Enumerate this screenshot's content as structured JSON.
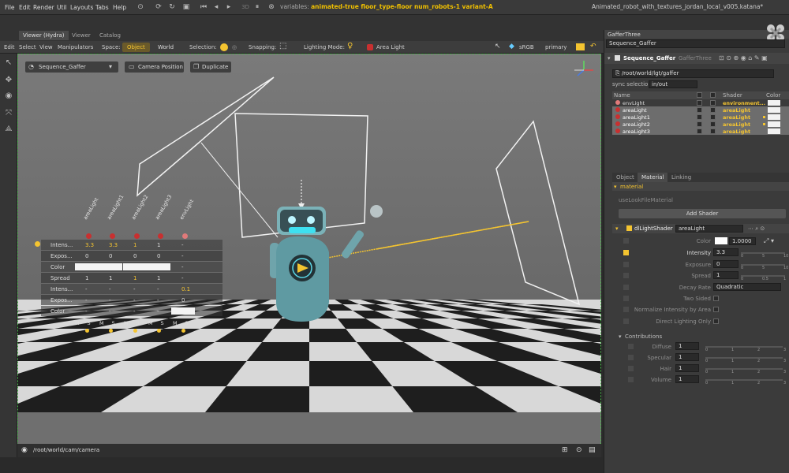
{
  "menubar": {
    "items": [
      "File",
      "Edit",
      "Render",
      "Util",
      "Layouts",
      "Tabs",
      "Help"
    ],
    "counter": "3D",
    "vars_prefix": "variables:",
    "vars_value": "animated-true floor_type-floor num_robots-1 variant-A",
    "filename": "Animated_robot_with_textures_jordan_local_v005.katana*"
  },
  "tabs": {
    "viewer": "Viewer (Hydra)",
    "viewer2": "Viewer",
    "catalog": "Catalog"
  },
  "viewerbar": {
    "menu": [
      "Edit",
      "Select",
      "View",
      "Manipulators"
    ],
    "space_label": "Space:",
    "object": "Object",
    "world": "World",
    "selection_label": "Selection:",
    "snapping_label": "Snapping:",
    "lighting_label": "Lighting Mode:",
    "area_light": "Area Light",
    "srgb": "sRGB",
    "primary": "primary"
  },
  "viewport": {
    "sequence": "Sequence_Gaffer",
    "camera_position": "Camera Position",
    "duplicate": "Duplicate",
    "camera_path": "/root/world/cam/camera",
    "hud": {
      "columns": [
        "areaLight",
        "areaLight1",
        "areaLight2",
        "areaLight3",
        "envLight"
      ],
      "rows": [
        {
          "label": "Intens...",
          "cells": [
            "3.3",
            "3.3",
            "1",
            "1",
            "-"
          ]
        },
        {
          "label": "Expos...",
          "cells": [
            "0",
            "0",
            "0",
            "0",
            "-"
          ]
        },
        {
          "label": "Color",
          "cells": [
            "",
            "",
            "",
            "",
            "-"
          ]
        },
        {
          "label": "Spread",
          "cells": [
            "1",
            "1",
            "1",
            "1",
            "-"
          ]
        },
        {
          "label": "Intens...",
          "cells": [
            "-",
            "-",
            "-",
            "-",
            "0.1"
          ]
        },
        {
          "label": "Expos...",
          "cells": [
            "-",
            "-",
            "-",
            "-",
            "0"
          ]
        },
        {
          "label": "Color",
          "cells": [
            "-",
            "-",
            "-",
            "-",
            ""
          ]
        }
      ],
      "ms": [
        "M",
        "S",
        "M",
        "S",
        "M",
        "S",
        "M",
        "S",
        "M",
        "S"
      ]
    }
  },
  "panel": {
    "title": "GafferThree",
    "node": "Sequence_Gaffer",
    "node_bold": "Sequence_Gaffer",
    "node_type": "GafferThree",
    "root_path": "/root/world/lgt/gaffer",
    "sync_label": "sync selection",
    "sync_value": "in/out",
    "table_headers": {
      "name": "Name",
      "shader": "Shader",
      "color": "Color"
    },
    "lights": [
      {
        "name": "envLight",
        "shader": "environment..."
      },
      {
        "name": "areaLight",
        "shader": "areaLight"
      },
      {
        "name": "areaLight1",
        "shader": "areaLight"
      },
      {
        "name": "areaLight2",
        "shader": "areaLight"
      },
      {
        "name": "areaLight3",
        "shader": "areaLight"
      }
    ],
    "subtabs": [
      "Object",
      "Material",
      "Linking"
    ],
    "material_header": "material",
    "use_look_file": "useLookFileMaterial",
    "add_shader": "Add Shader",
    "shader_name": "dlLightShader",
    "shader_value": "areaLight",
    "params": [
      {
        "label": "Color",
        "value": "1.0000"
      },
      {
        "label": "Intensity",
        "value": "3.3"
      },
      {
        "label": "Exposure",
        "value": "0"
      },
      {
        "label": "Spread",
        "value": "1"
      },
      {
        "label": "Decay Rate",
        "value": "Quadratic"
      },
      {
        "label": "Two Sided",
        "value": ""
      },
      {
        "label": "Normalize Intensity by Area",
        "value": ""
      },
      {
        "label": "Direct Lighting Only",
        "value": ""
      }
    ],
    "contributions": "Contributions",
    "contrib": [
      {
        "label": "Diffuse",
        "value": "1"
      },
      {
        "label": "Specular",
        "value": "1"
      },
      {
        "label": "Hair",
        "value": "1"
      },
      {
        "label": "Volume",
        "value": "1"
      }
    ],
    "ticks_a": [
      "0",
      "5",
      "10"
    ],
    "ticks_b": [
      "0",
      "0.5",
      "1"
    ],
    "ticks_c": [
      "0",
      "1",
      "2",
      "3"
    ]
  },
  "colors": {
    "accent": "#f4c430",
    "select_row": "#8a8a8a",
    "light_red": "#c83030"
  }
}
